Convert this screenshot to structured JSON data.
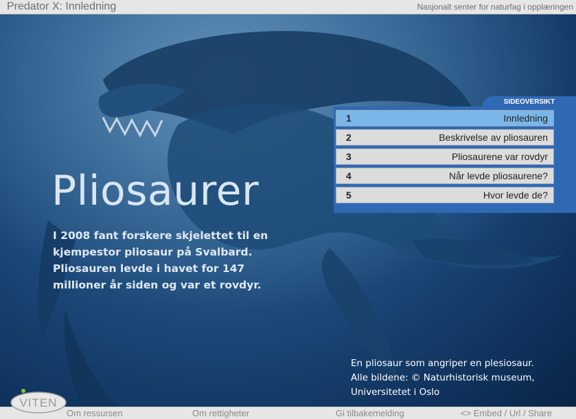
{
  "window": {
    "title": "Predator X: Innledning",
    "organization": "Nasjonalt senter for naturfag i opplæringen"
  },
  "hero": {
    "title": "Pliosaurer",
    "intro": "I 2008 fant forskere skjelettet til en kjempestor pliosaur på Svalbard. Pliosauren levde i havet for 147 millioner år siden og var et rovdyr.",
    "caption_line1": "En pliosaur som angriper en plesiosaur.",
    "caption_line2": "Alle bildene: © Naturhistorisk museum,",
    "caption_line3": "Universitetet i Oslo"
  },
  "sideoversikt": {
    "heading": "SIDEOVERSIKT",
    "items": [
      {
        "num": "1",
        "label": "Innledning",
        "active": true
      },
      {
        "num": "2",
        "label": "Beskrivelse av pliosauren",
        "active": false
      },
      {
        "num": "3",
        "label": "Pliosaurene var rovdyr",
        "active": false
      },
      {
        "num": "4",
        "label": "Når levde pliosaurene?",
        "active": false
      },
      {
        "num": "5",
        "label": "Hvor levde de?",
        "active": false
      }
    ]
  },
  "footer": {
    "logo_text": "VITEN",
    "about": "Om ressursen",
    "rights": "Om rettigheter",
    "feedback": "Gi tilbakemelding",
    "share": "<> Embed / Url / Share"
  },
  "colors": {
    "accent": "#2f69b3",
    "active_item": "#7ab7e9",
    "ocean_dark": "#0e2f58"
  }
}
